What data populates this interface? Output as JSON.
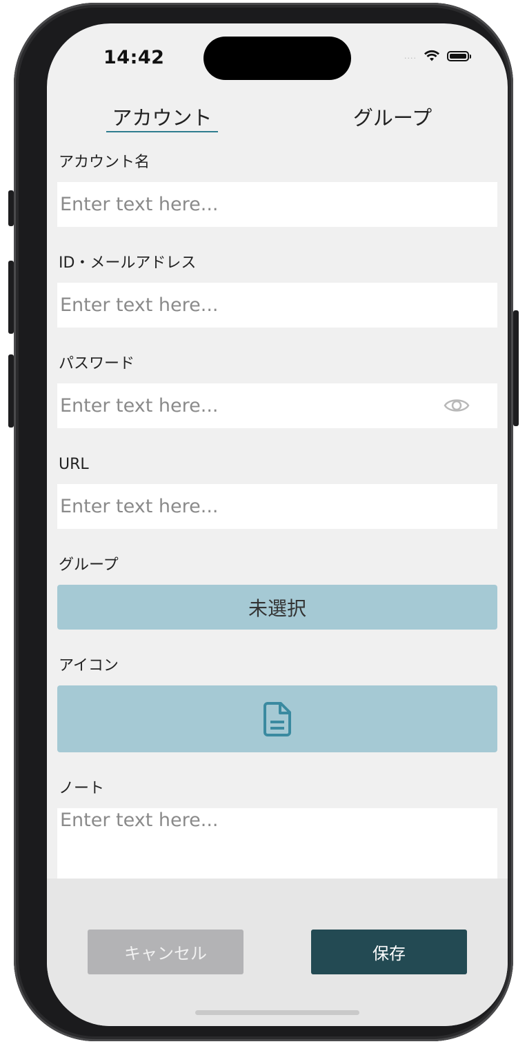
{
  "status_bar": {
    "time": "14:42",
    "signal": "....",
    "wifi_icon": "wifi-icon",
    "battery_icon": "battery-icon"
  },
  "tabs": [
    {
      "label": "アカウント",
      "active": true
    },
    {
      "label": "グループ",
      "active": false
    }
  ],
  "form": {
    "account_name": {
      "label": "アカウント名",
      "placeholder": "Enter text here...",
      "value": ""
    },
    "id_email": {
      "label": "ID・メールアドレス",
      "placeholder": "Enter text here...",
      "value": ""
    },
    "password": {
      "label": "パスワード",
      "placeholder": "Enter text here...",
      "value": "",
      "toggle_icon": "eye-icon"
    },
    "url": {
      "label": "URL",
      "placeholder": "Enter text here...",
      "value": ""
    },
    "group": {
      "label": "グループ",
      "selected": "未選択"
    },
    "icon": {
      "label": "アイコン",
      "icon": "document-icon"
    },
    "note": {
      "label": "ノート",
      "placeholder": "Enter text here...",
      "value": ""
    }
  },
  "actions": {
    "cancel_label": "キャンセル",
    "save_label": "保存"
  },
  "colors": {
    "accent": "#2e7d8f",
    "select_bg": "#a5c9d4",
    "save_bg": "#234a53",
    "cancel_bg": "#b3b3b5",
    "icon_color": "#3a8aa0"
  }
}
